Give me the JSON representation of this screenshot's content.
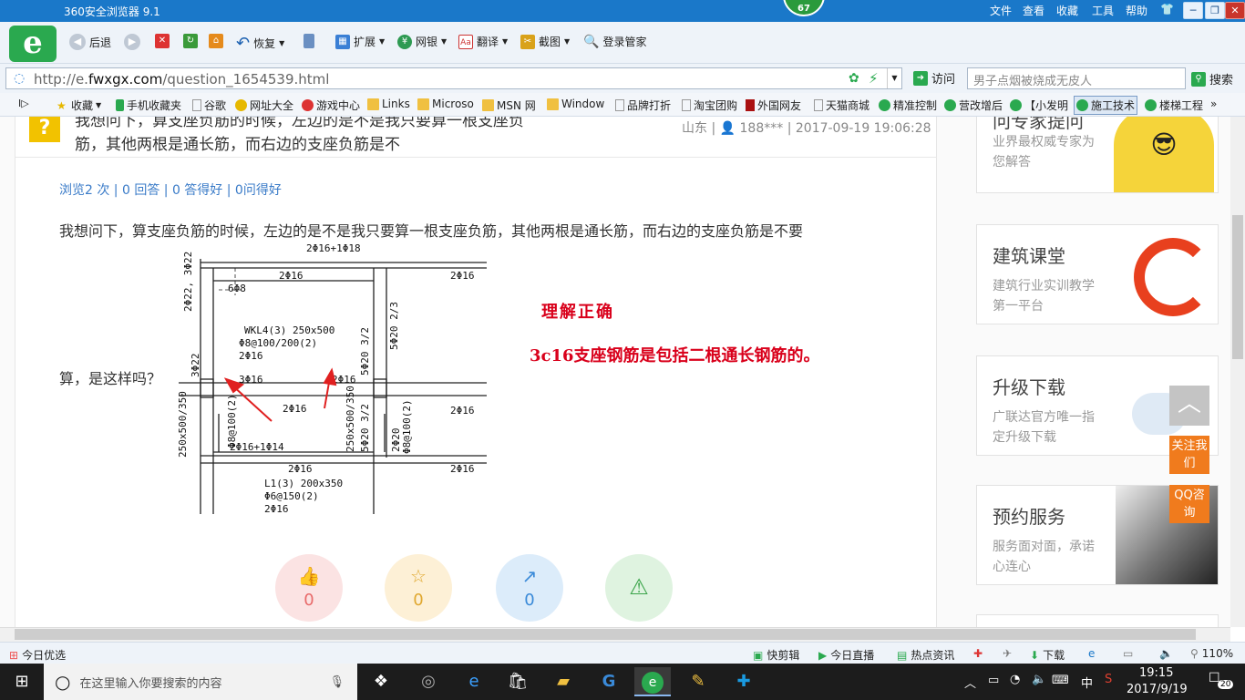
{
  "browser": {
    "title": "360安全浏览器 9.1",
    "badge_count": "67",
    "menu": [
      "文件",
      "查看",
      "收藏",
      "工具",
      "帮助"
    ],
    "window_buttons": [
      "最小化",
      "最大化",
      "关闭"
    ]
  },
  "toolbar": {
    "back": "后退",
    "restore": "恢复",
    "extend": "扩展",
    "netbank": "网银",
    "translate": "翻译",
    "screenshot": "截图",
    "login": "登录管家"
  },
  "address": {
    "url_prefix": "http://e.",
    "url_domain": "fwxgx.com",
    "url_path": "/question_1654539.html",
    "visit": "访问",
    "search_placeholder": "男子点烟被烧成无皮人",
    "search": "搜索"
  },
  "favorites": [
    "收藏",
    "手机收藏夹",
    "谷歌",
    "网址大全",
    "游戏中心",
    "Links",
    "Microso",
    "MSN 网",
    "Window",
    "品牌打折",
    "淘宝团购",
    "外国网友",
    "天猫商城",
    "精准控制",
    "营改增后",
    "【小发明",
    "施工技术",
    "楼梯工程"
  ],
  "question": {
    "title_line1": "我想问下，算支座负筋的时候，左边的是不是我只要算一根支座负",
    "title_line2": "筋，其他两根是通长筋，而右边的支座负筋是不",
    "location": "山东",
    "user": "188***",
    "datetime": "2017-09-19 19:06:28",
    "stats": "浏览2 次 | 0 回答 | 0 答得好 | 0问得好",
    "body_line1": "我想问下，算支座负筋的时候，左边的是不是我只要算一根支座负筋，其他两根是通长筋，而右边的支座负筋是不要",
    "body_line2": "算，是这样吗？",
    "answer1": "理解正确",
    "answer2": "3c16支座钢筋是包括二根通长钢筋的。",
    "actions": [
      {
        "name": "like",
        "count": "0"
      },
      {
        "name": "favorite",
        "count": "0"
      },
      {
        "name": "share",
        "count": "0"
      },
      {
        "name": "report",
        "count": ""
      }
    ]
  },
  "drawing_labels": {
    "top_bar": "2Φ16+1Φ18",
    "top_mid": "2Φ16",
    "left_top": "2Φ22, 3Φ22",
    "stirrup": "6Φ8",
    "beam_name": "WKL4(3) 250x500",
    "beam_stirrup": "Φ8@100/200(2)",
    "beam_top": "2Φ16",
    "left_mid": "3Φ22",
    "support_left": "3Φ16",
    "support_right": "2Φ16",
    "right_vert": "5Φ20 3/2",
    "bottom_mid": "2Φ16",
    "right_far": "2Φ16",
    "l1_name": "L1(3) 200x350",
    "l1_stirrup": "Φ6@150(2)",
    "l1_bottom": "2Φ16",
    "left_bottom_bar": "2Φ16+1Φ14",
    "left_vert": "Φ8@100(2)",
    "left_sec": "250x500/350",
    "right_sec": "250x500/350",
    "right_rebar": "5Φ20 3/2",
    "far_right_vert": "Φ8@100(2)",
    "far_bot": "2Φ16",
    "mid_low": "2Φ16",
    "far_top": "2Φ16",
    "right_upper": "5Φ20 2/3",
    "right_narrow": "2Φ20"
  },
  "sidebar": {
    "cards": [
      {
        "title": "问专家提问",
        "sub": "业界最权威专家为您解答"
      },
      {
        "title": "建筑课堂",
        "sub": "建筑行业实训教学第一平台"
      },
      {
        "title": "升级下载",
        "sub": "广联达官方唯一指定升级下载"
      },
      {
        "title": "预约服务",
        "sub": "服务面对面，承诺心连心"
      }
    ],
    "follow": "关注我们",
    "qq": "QQ咨询"
  },
  "statusbar": {
    "left": "今日优选",
    "items": [
      "快剪辑",
      "今日直播",
      "热点资讯",
      "下载"
    ],
    "zoom": "110%"
  },
  "taskbar": {
    "search_placeholder": "在这里输入你要搜索的内容",
    "ime": "中",
    "time": "19:15",
    "date": "2017/9/19",
    "notifications": "20"
  }
}
